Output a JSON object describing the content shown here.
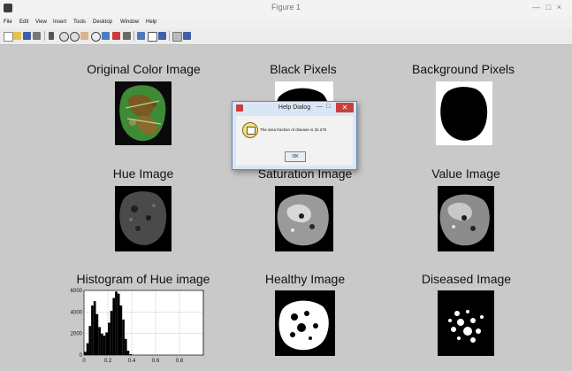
{
  "window": {
    "title": "Figure 1",
    "controls": "— □ ×"
  },
  "menubar": {
    "items": [
      "File",
      "Edit",
      "View",
      "Insert",
      "Tools",
      "Desktop",
      "Window",
      "Help"
    ]
  },
  "toolbar": {
    "icons": [
      "new-figure-icon",
      "open-icon",
      "save-icon",
      "print-icon",
      "edit-plot-icon",
      "zoom-in-icon",
      "zoom-out-icon",
      "pan-icon",
      "rotate-icon",
      "data-cursor-icon",
      "brush-icon",
      "link-icon",
      "colorbar-icon",
      "legend-icon",
      "hide-tools-icon",
      "show-tools-icon"
    ]
  },
  "panels": {
    "original": {
      "title": "Original Color Image"
    },
    "black": {
      "title": "Black Pixels"
    },
    "background": {
      "title": "Background Pixels"
    },
    "hue": {
      "title": "Hue Image"
    },
    "saturation": {
      "title": "Saturation Image"
    },
    "value": {
      "title": "Value Image"
    },
    "histogram": {
      "title": "Histogram of Hue image"
    },
    "healthy": {
      "title": "Healthy Image"
    },
    "diseased": {
      "title": "Diseased Image"
    }
  },
  "dialog": {
    "title": "Help Dialog",
    "message": "The area fraction of disease is 32.275",
    "ok_label": "OK",
    "min_glyph": "—",
    "max_glyph": "□",
    "close_glyph": "✕"
  },
  "chart_data": {
    "type": "bar",
    "title": "Histogram of Hue image",
    "xlabel": "",
    "ylabel": "",
    "xlim": [
      0,
      1
    ],
    "ylim": [
      0,
      6000
    ],
    "xticks": [
      "0",
      "0.2",
      "0.4",
      "0.6",
      "0.8"
    ],
    "yticks": [
      "0",
      "2000",
      "4000",
      "6000"
    ],
    "grid": true,
    "bin_centers": [
      0.01,
      0.03,
      0.05,
      0.07,
      0.09,
      0.11,
      0.13,
      0.15,
      0.17,
      0.19,
      0.21,
      0.23,
      0.25,
      0.27,
      0.29,
      0.31,
      0.33,
      0.35,
      0.37,
      0.39,
      0.41
    ],
    "counts": [
      300,
      1100,
      2700,
      4600,
      5000,
      3800,
      2600,
      2000,
      1800,
      2100,
      3000,
      4100,
      5300,
      5900,
      5700,
      4600,
      3300,
      1500,
      400,
      80,
      20
    ]
  }
}
